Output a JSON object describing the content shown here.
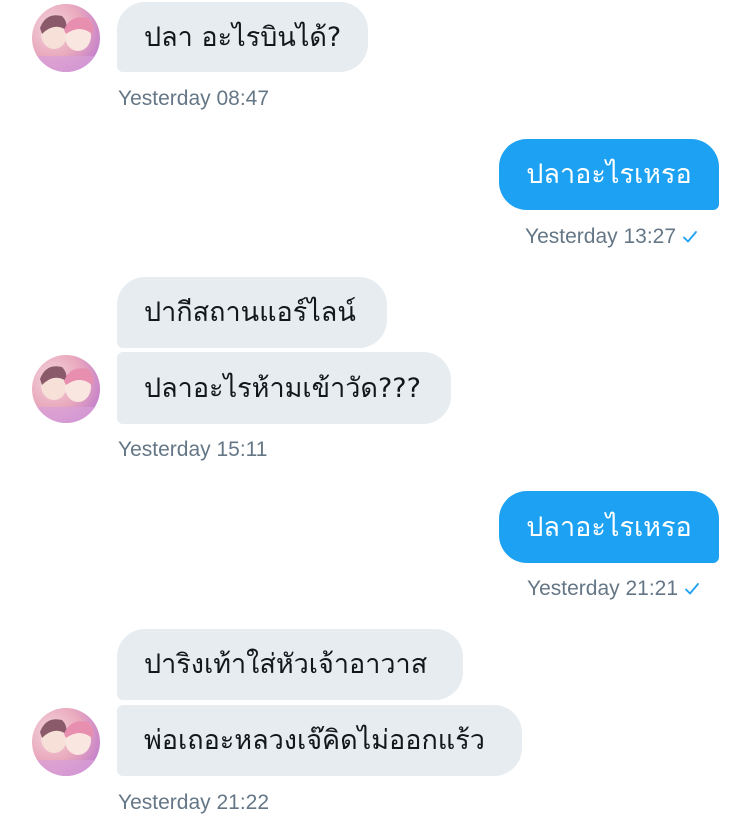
{
  "colors": {
    "incoming_bubble": "#e6ecf0",
    "outgoing_bubble": "#1da1f2",
    "timestamp": "#657786",
    "read_check": "#1da1f2"
  },
  "messages": [
    {
      "direction": "incoming",
      "text": "ปลา อะไรบินได้?"
    },
    {
      "direction": "outgoing",
      "text": "ปลาอะไรเหรอ"
    },
    {
      "direction": "incoming",
      "text": "ปากีสถานแอร์ไลน์"
    },
    {
      "direction": "incoming",
      "text": "ปลาอะไรห้ามเข้าวัด???"
    },
    {
      "direction": "outgoing",
      "text": "ปลาอะไรเหรอ"
    },
    {
      "direction": "incoming",
      "text": "ปาริงเท้าใส่หัวเจ้าอาวาส"
    },
    {
      "direction": "incoming",
      "text": "พ่อเถอะหลวงเจ๊คิดไม่ออกแร้ว"
    }
  ],
  "timestamps": [
    "Yesterday 08:47",
    "Yesterday 13:27",
    "Yesterday 15:11",
    "Yesterday 21:21",
    "Yesterday 21:22"
  ],
  "icons": {
    "avatar": "user-avatar-icon",
    "read_receipt": "checkmark-icon"
  }
}
